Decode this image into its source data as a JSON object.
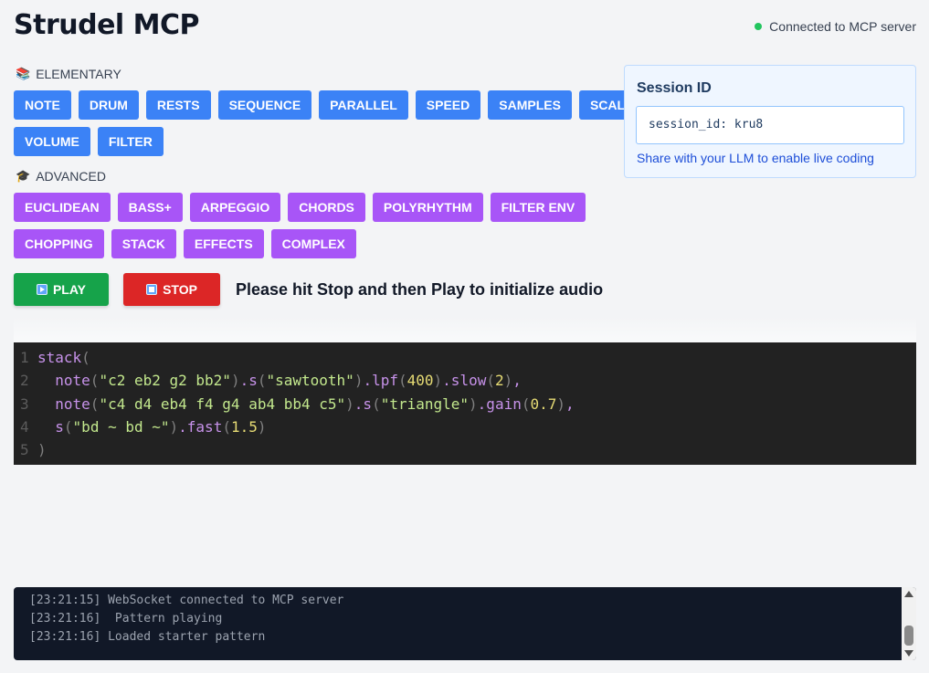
{
  "app": {
    "title": "Strudel MCP",
    "connection_status": "Connected to MCP server",
    "status_color": "#22c55e"
  },
  "elementary": {
    "label": "ELEMENTARY",
    "icon": "books-icon",
    "buttons": [
      "NOTE",
      "DRUM",
      "RESTS",
      "SEQUENCE",
      "PARALLEL",
      "SPEED",
      "SAMPLES",
      "SCALE",
      "VOLUME",
      "FILTER"
    ],
    "color": "#3b82f6"
  },
  "advanced": {
    "label": "ADVANCED",
    "icon": "graduation-cap-icon",
    "buttons": [
      "EUCLIDEAN",
      "BASS+",
      "ARPEGGIO",
      "CHORDS",
      "POLYRHYTHM",
      "FILTER ENV",
      "CHOPPING",
      "STACK",
      "EFFECTS",
      "COMPLEX"
    ],
    "color": "#a855f7"
  },
  "session": {
    "title": "Session ID",
    "value": "session_id: kru8",
    "hint": "Share with your LLM to enable live coding"
  },
  "controls": {
    "play_label": "PLAY",
    "stop_label": "STOP",
    "message": "Please hit Stop and then Play to initialize audio"
  },
  "editor": {
    "line_numbers": [
      "1",
      "2",
      "3",
      "4",
      "5"
    ]
  },
  "log": {
    "entries": [
      "[23:21:15] WebSocket connected to MCP server",
      "[23:21:16]  Pattern playing",
      "[23:21:16] Loaded starter pattern"
    ]
  }
}
